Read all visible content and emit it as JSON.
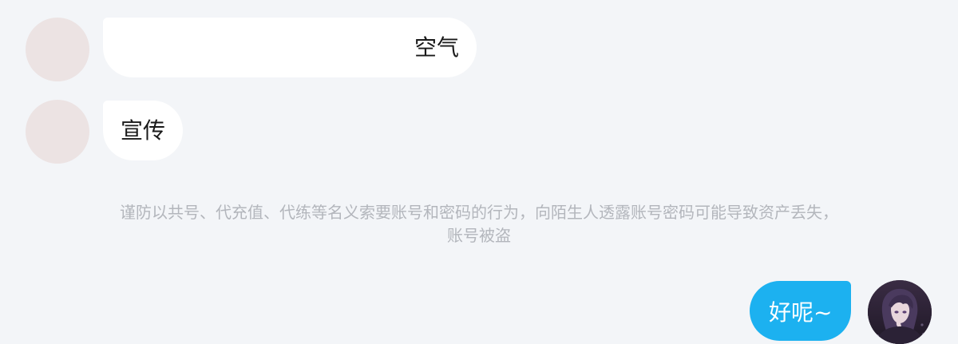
{
  "messages": {
    "incoming_1": {
      "text": "空气"
    },
    "incoming_2": {
      "text": "宣传"
    },
    "outgoing_1": {
      "text": "好呢~"
    }
  },
  "notice": {
    "line1": "谨防以共号、代充值、代练等名义索要账号和密码的行为，向陌生人透露账号密码可能导致资产丢失，",
    "line2": "账号被盗"
  },
  "colors": {
    "page_background": "#f3f5f8",
    "incoming_bubble": "#ffffff",
    "outgoing_bubble": "#1cb1f0",
    "avatar_placeholder": "#ece3e3",
    "notice_text": "#b3b6bc"
  }
}
